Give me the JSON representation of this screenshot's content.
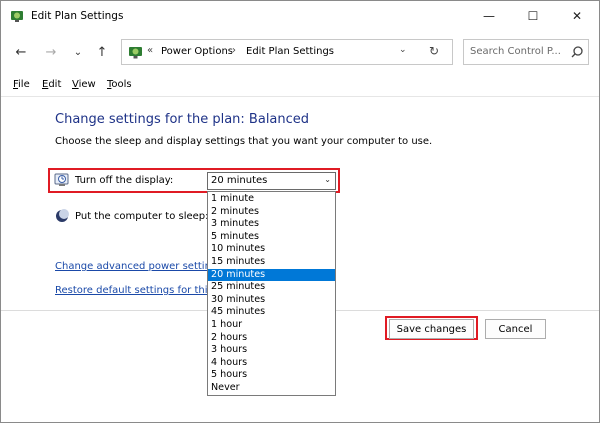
{
  "window": {
    "title": "Edit Plan Settings",
    "minimize_glyph": "—",
    "maximize_glyph": "☐",
    "close_glyph": "✕"
  },
  "nav": {
    "back_glyph": "←",
    "forward_glyph": "→",
    "recent_glyph": "⌄",
    "up_glyph": "↑"
  },
  "address": {
    "separator": "«",
    "crumbs": [
      "Power Options",
      "Edit Plan Settings"
    ],
    "crumb_arrow": "›",
    "dropdown_glyph": "⌄",
    "refresh_glyph": "↻"
  },
  "search": {
    "placeholder": "Search Control P..."
  },
  "menu": {
    "file": {
      "key": "F",
      "rest": "ile"
    },
    "edit": {
      "key": "E",
      "rest": "dit"
    },
    "view": {
      "key": "V",
      "rest": "iew"
    },
    "tools": {
      "key": "T",
      "rest": "ools"
    }
  },
  "main": {
    "heading": "Change settings for the plan: Balanced",
    "subtitle": "Choose the sleep and display settings that you want your computer to use.",
    "display_label": "Turn off the display:",
    "display_value": "20 minutes",
    "select_arrow": "⌄",
    "sleep_label": "Put the computer to sleep:",
    "advanced_link": "Change advanced power settings",
    "restore_link": "Restore default settings for this pla"
  },
  "dropdown": {
    "options": [
      "1 minute",
      "2 minutes",
      "3 minutes",
      "5 minutes",
      "10 minutes",
      "15 minutes",
      "20 minutes",
      "25 minutes",
      "30 minutes",
      "45 minutes",
      "1 hour",
      "2 hours",
      "3 hours",
      "4 hours",
      "5 hours",
      "Never"
    ],
    "selected": "20 minutes"
  },
  "buttons": {
    "save": "Save changes",
    "cancel": "Cancel"
  },
  "colors": {
    "highlight_border": "#e01b24",
    "link": "#1a49a8",
    "heading": "#1e3287",
    "selection": "#0078d7"
  }
}
